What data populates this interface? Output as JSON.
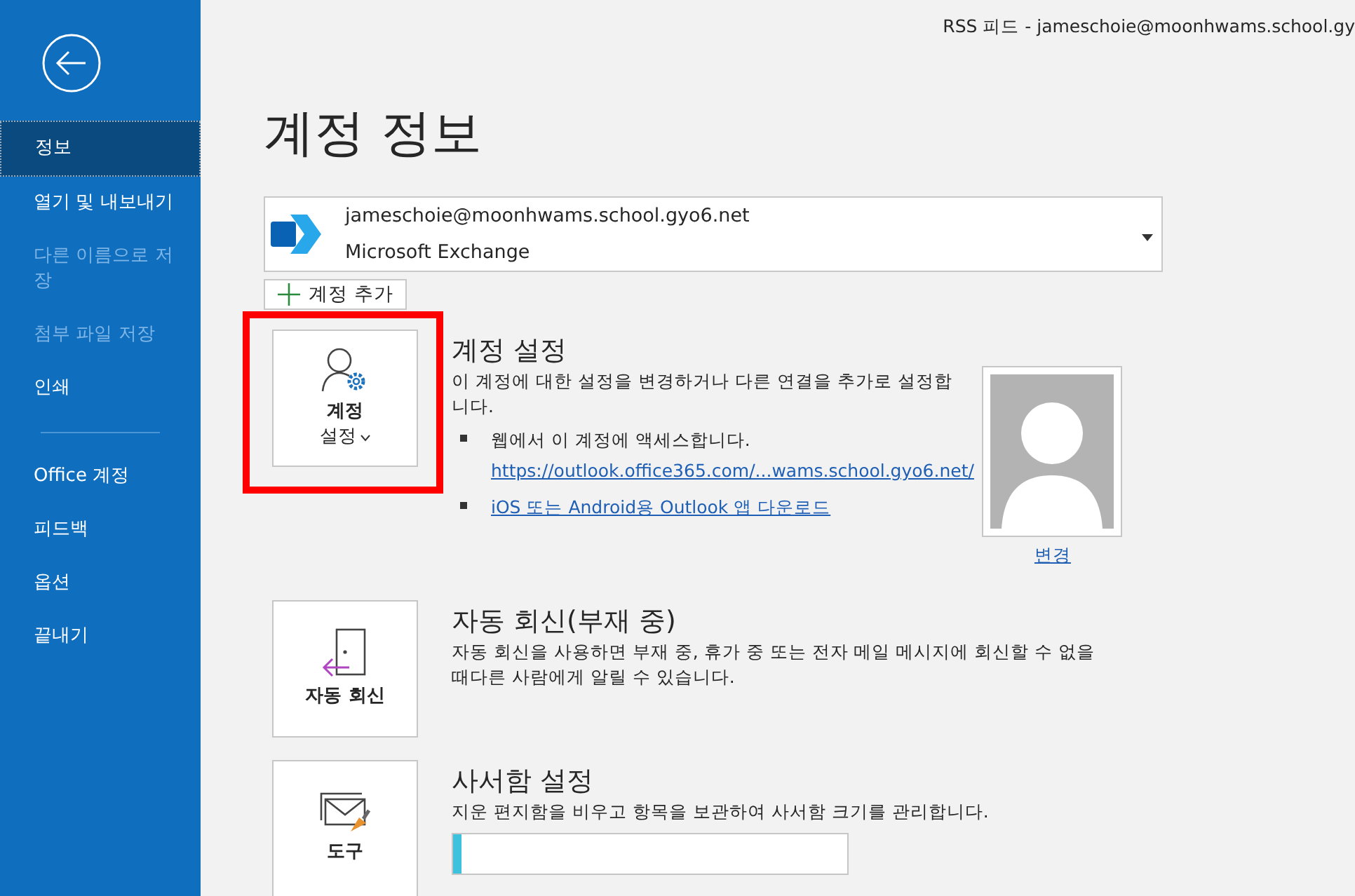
{
  "window": {
    "title": "RSS 피드 - jameschoie@moonhwams.school.gy"
  },
  "sidebar": {
    "items": [
      {
        "label": "정보",
        "selected": true,
        "disabled": false
      },
      {
        "label": "열기 및 내보내기",
        "selected": false,
        "disabled": false
      },
      {
        "label": "다른 이름으로 저장",
        "selected": false,
        "disabled": true
      },
      {
        "label": "첨부 파일 저장",
        "selected": false,
        "disabled": true
      },
      {
        "label": "인쇄",
        "selected": false,
        "disabled": false
      },
      {
        "label": "Office 계정",
        "selected": false,
        "disabled": false,
        "divider_before": true
      },
      {
        "label": "피드백",
        "selected": false,
        "disabled": false
      },
      {
        "label": "옵션",
        "selected": false,
        "disabled": false
      },
      {
        "label": "끝내기",
        "selected": false,
        "disabled": false
      }
    ]
  },
  "page_title": "계정 정보",
  "account": {
    "email": "jameschoie@moonhwams.school.gyo6.net",
    "type": "Microsoft Exchange"
  },
  "add_account": "계정 추가",
  "sections": [
    {
      "kind": "account",
      "button": [
        "계정",
        "설정"
      ],
      "highlighted": true,
      "title": "계정 설정",
      "description": "이 계정에 대한 설정을 변경하거나 다른 연결을 추가로 설정합니다.",
      "bullets": [
        {
          "text": "웹에서 이 계정에 액세스합니다.",
          "link": "https://outlook.office365.com/...wams.school.gyo6.net/"
        },
        {
          "link": "iOS 또는 Android용 Outlook 앱 다운로드"
        }
      ],
      "photo_link": "변경"
    },
    {
      "kind": "autoreply",
      "button": [
        "자동 회신"
      ],
      "highlighted": false,
      "title": "자동 회신(부재 중)",
      "description": "자동 회신을 사용하면 부재 중, 휴가 중 또는 전자 메일 메시지에 회신할 수 없을 때다른 사람에게 알릴 수 있습니다."
    },
    {
      "kind": "mailbox",
      "button": [
        "도구"
      ],
      "highlighted": false,
      "title": "사서함 설정",
      "description": "지운 편지함을 비우고 항목을 보관하여 사서함 크기를 관리합니다.",
      "level": 0.02
    }
  ]
}
